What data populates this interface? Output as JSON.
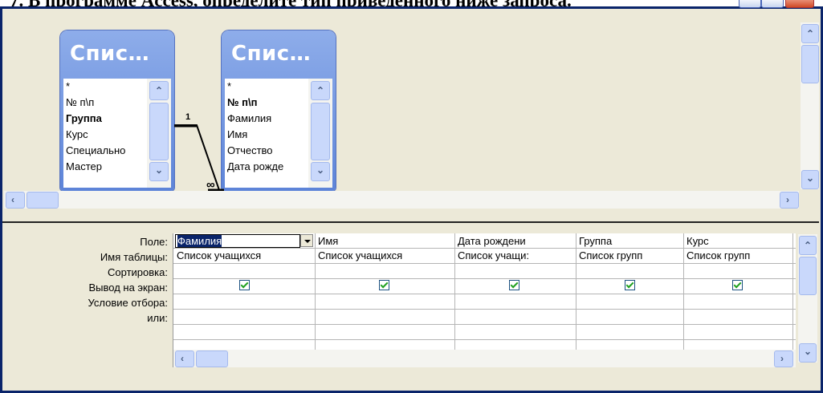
{
  "question": "7. В программе Access, определите тип приведенного ниже запроса.",
  "tables": [
    {
      "title": "Спис…",
      "fields": [
        {
          "name": "*",
          "bold": false
        },
        {
          "name": "№ п\\п",
          "bold": false
        },
        {
          "name": "Группа",
          "bold": true
        },
        {
          "name": "Курс",
          "bold": false
        },
        {
          "name": "Специально",
          "bold": false
        },
        {
          "name": "Мастер",
          "bold": false
        }
      ]
    },
    {
      "title": "Спис…",
      "fields": [
        {
          "name": "*",
          "bold": false
        },
        {
          "name": "№ п\\п",
          "bold": true
        },
        {
          "name": "Фамилия",
          "bold": false
        },
        {
          "name": "Имя",
          "bold": false
        },
        {
          "name": "Отчество",
          "bold": false
        },
        {
          "name": "Дата рожде",
          "bold": false
        }
      ]
    }
  ],
  "relation": {
    "one_label": "1",
    "many_label": "∞"
  },
  "grid_labels": {
    "field": "Поле:",
    "table": "Имя таблицы:",
    "sort": "Сортировка:",
    "show": "Вывод на экран:",
    "criteria": "Условие отбора:",
    "or": "или:"
  },
  "columns": [
    {
      "field": "Фамилия",
      "table": "Список учащихся",
      "show": true
    },
    {
      "field": "Имя",
      "table": "Список учащихся",
      "show": true
    },
    {
      "field": "Дата рождени",
      "table": "Список учащи:",
      "show": true
    },
    {
      "field": "Группа",
      "table": "Список групп",
      "show": true
    },
    {
      "field": "Курс",
      "table": "Список групп",
      "show": true
    }
  ],
  "colors": {
    "window_frame": "#0a246a",
    "field_list_title": "#6f92df",
    "workspace": "#ece9d8"
  }
}
